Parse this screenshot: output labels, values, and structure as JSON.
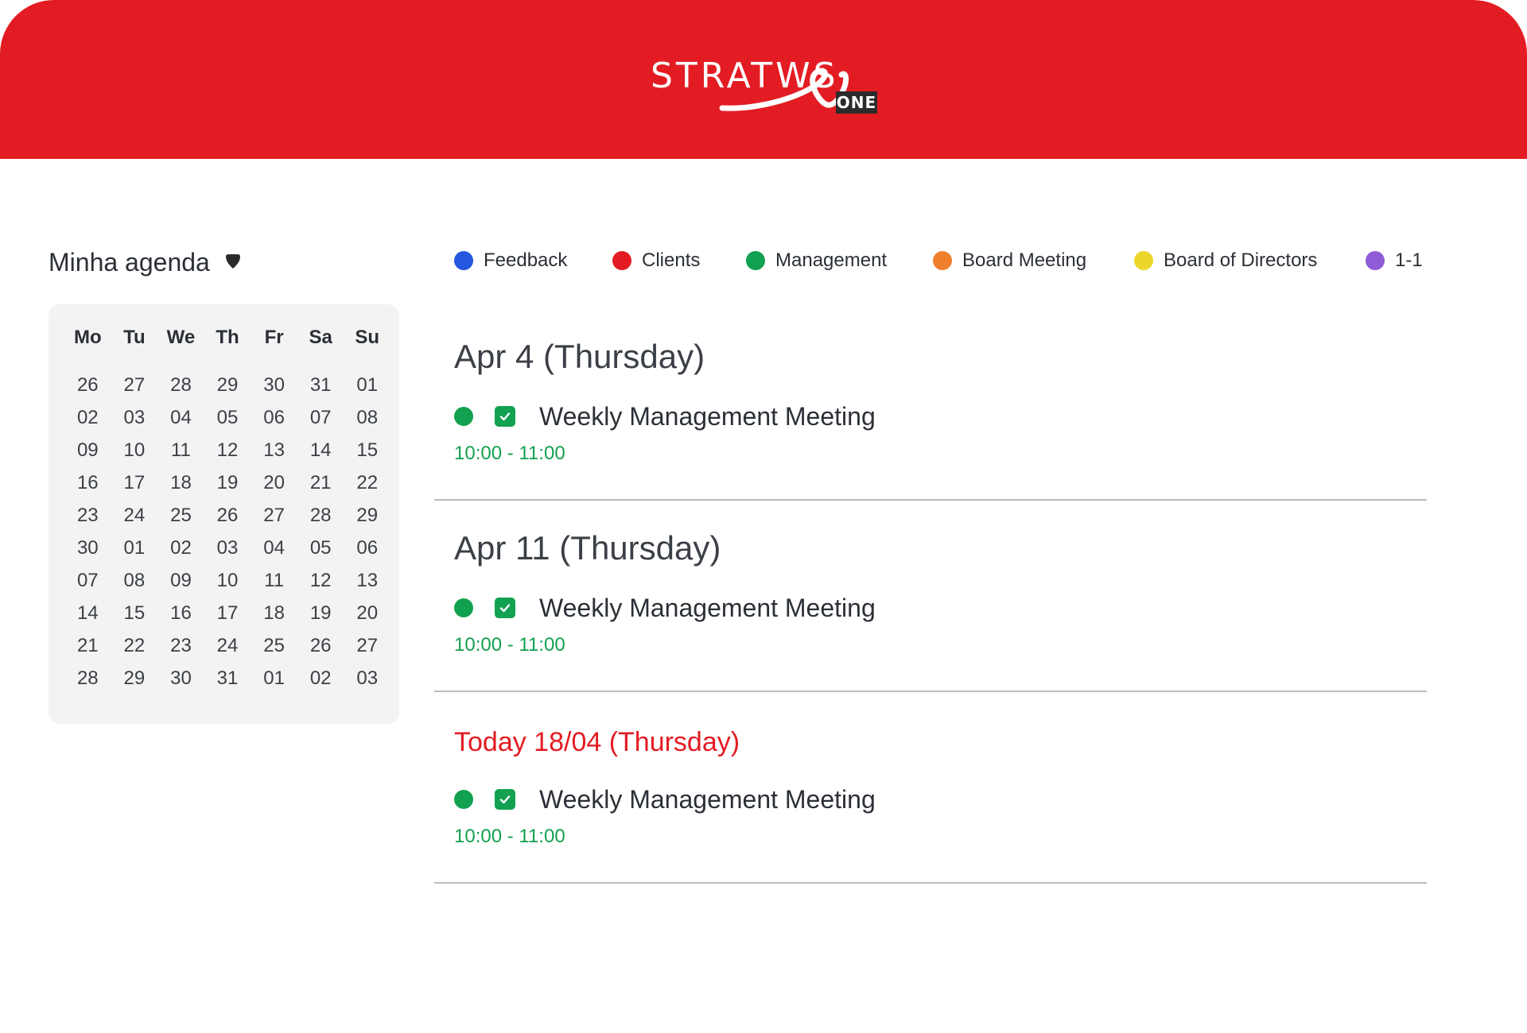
{
  "header": {
    "logo_text": "STRATWS",
    "logo_badge": "ONE",
    "brand_color": "#e31c23"
  },
  "agenda": {
    "title": "Minha agenda",
    "dropdown_icon": "caret-down-icon"
  },
  "calendar": {
    "weekdays": [
      "Mo",
      "Tu",
      "We",
      "Th",
      "Fr",
      "Sa",
      "Su"
    ],
    "weeks": [
      [
        "26",
        "27",
        "28",
        "29",
        "30",
        "31",
        "01"
      ],
      [
        "02",
        "03",
        "04",
        "05",
        "06",
        "07",
        "08"
      ],
      [
        "09",
        "10",
        "11",
        "12",
        "13",
        "14",
        "15"
      ],
      [
        "16",
        "17",
        "18",
        "19",
        "20",
        "21",
        "22"
      ],
      [
        "23",
        "24",
        "25",
        "26",
        "27",
        "28",
        "29"
      ],
      [
        "30",
        "01",
        "02",
        "03",
        "04",
        "05",
        "06"
      ],
      [
        "07",
        "08",
        "09",
        "10",
        "11",
        "12",
        "13"
      ],
      [
        "14",
        "15",
        "16",
        "17",
        "18",
        "19",
        "20"
      ],
      [
        "21",
        "22",
        "23",
        "24",
        "25",
        "26",
        "27"
      ],
      [
        "28",
        "29",
        "30",
        "31",
        "01",
        "02",
        "03"
      ]
    ]
  },
  "legend": [
    {
      "label": "Feedback",
      "color": "#2457e0"
    },
    {
      "label": "Clients",
      "color": "#e31c23"
    },
    {
      "label": "Management",
      "color": "#12a150"
    },
    {
      "label": "Board Meeting",
      "color": "#f07f2d"
    },
    {
      "label": "Board of Directors",
      "color": "#ecd62a"
    },
    {
      "label": "1-1",
      "color": "#8f5bd6"
    }
  ],
  "days": [
    {
      "title": "Apr 4 (Thursday)",
      "is_today": false,
      "event": {
        "title": "Weekly Management Meeting",
        "time": "10:00 - 11:00",
        "color": "#12a150",
        "checked": true
      }
    },
    {
      "title": "Apr 11 (Thursday)",
      "is_today": false,
      "event": {
        "title": "Weekly Management Meeting",
        "time": "10:00 - 11:00",
        "color": "#12a150",
        "checked": true
      }
    },
    {
      "title": "Today 18/04  (Thursday)",
      "is_today": true,
      "event": {
        "title": "Weekly Management Meeting",
        "time": "10:00 - 11:00",
        "color": "#12a150",
        "checked": true
      }
    }
  ]
}
